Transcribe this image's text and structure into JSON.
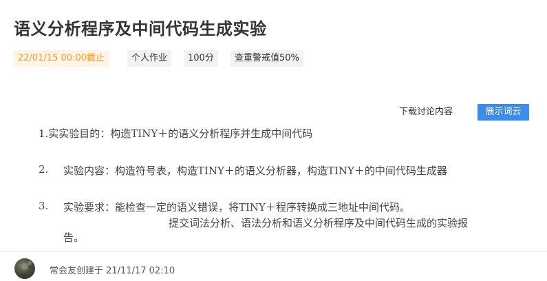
{
  "assignment": {
    "title": "语义分析程序及中间代码生成实验",
    "tags": {
      "deadline": "22/01/15 00:00截止",
      "type": "个人作业",
      "score": "100分",
      "plagiarism": "查重警戒值50%"
    },
    "actions": {
      "download_discussion": "下载讨论内容",
      "show_word_cloud": "展示词云"
    },
    "content": {
      "line1": "1.实实验目的：构造TINY＋的语义分析程序并生成中间代码",
      "line2_num": "2.",
      "line2_text": "实验内容：构造符号表，构造TINY＋的语义分析器，构造TINY＋的中间代码生成器",
      "line3_num": "3.",
      "line3_text": "实验要求：能检查一定的语义错误，将TINY＋程序转换成三地址中间代码。",
      "line4": "提交词法分析、语法分析和语义分析程序及中间代码生成的实验报",
      "line5": "告。"
    },
    "creator": {
      "text": "常会友创建于 21/11/17 02:10"
    }
  },
  "colors": {
    "deadline_text": "#ff9a2e",
    "deadline_bg": "#fff4e6",
    "primary_button": "#3a8ee6",
    "tag_bg": "#f2f2f2"
  }
}
